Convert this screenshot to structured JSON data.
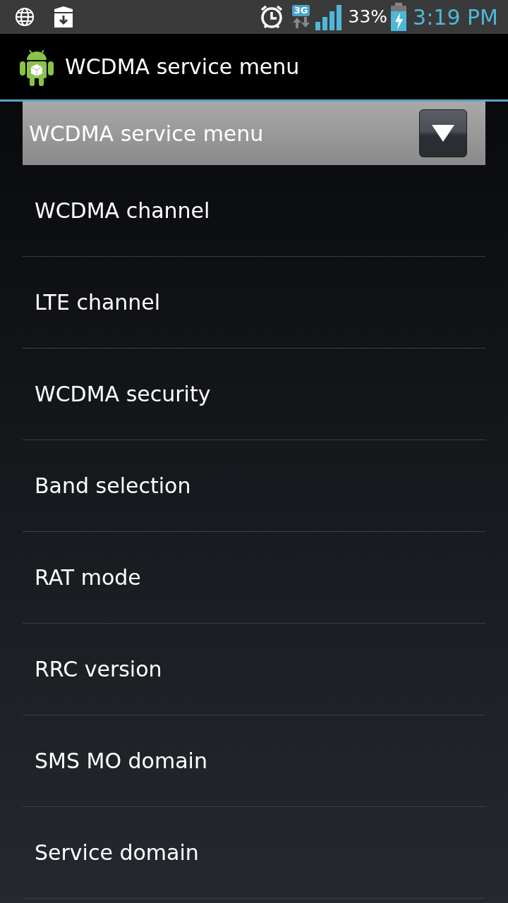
{
  "status_bar": {
    "network": "3G",
    "battery": "33%",
    "time": "3:19 PM"
  },
  "app_bar": {
    "title": "WCDMA service menu"
  },
  "spinner": {
    "value": "WCDMA service menu"
  },
  "items": [
    {
      "label": "WCDMA channel"
    },
    {
      "label": "LTE channel"
    },
    {
      "label": "WCDMA security"
    },
    {
      "label": "Band selection"
    },
    {
      "label": "RAT mode"
    },
    {
      "label": "RRC version"
    },
    {
      "label": "SMS MO domain"
    },
    {
      "label": "Service domain"
    }
  ]
}
